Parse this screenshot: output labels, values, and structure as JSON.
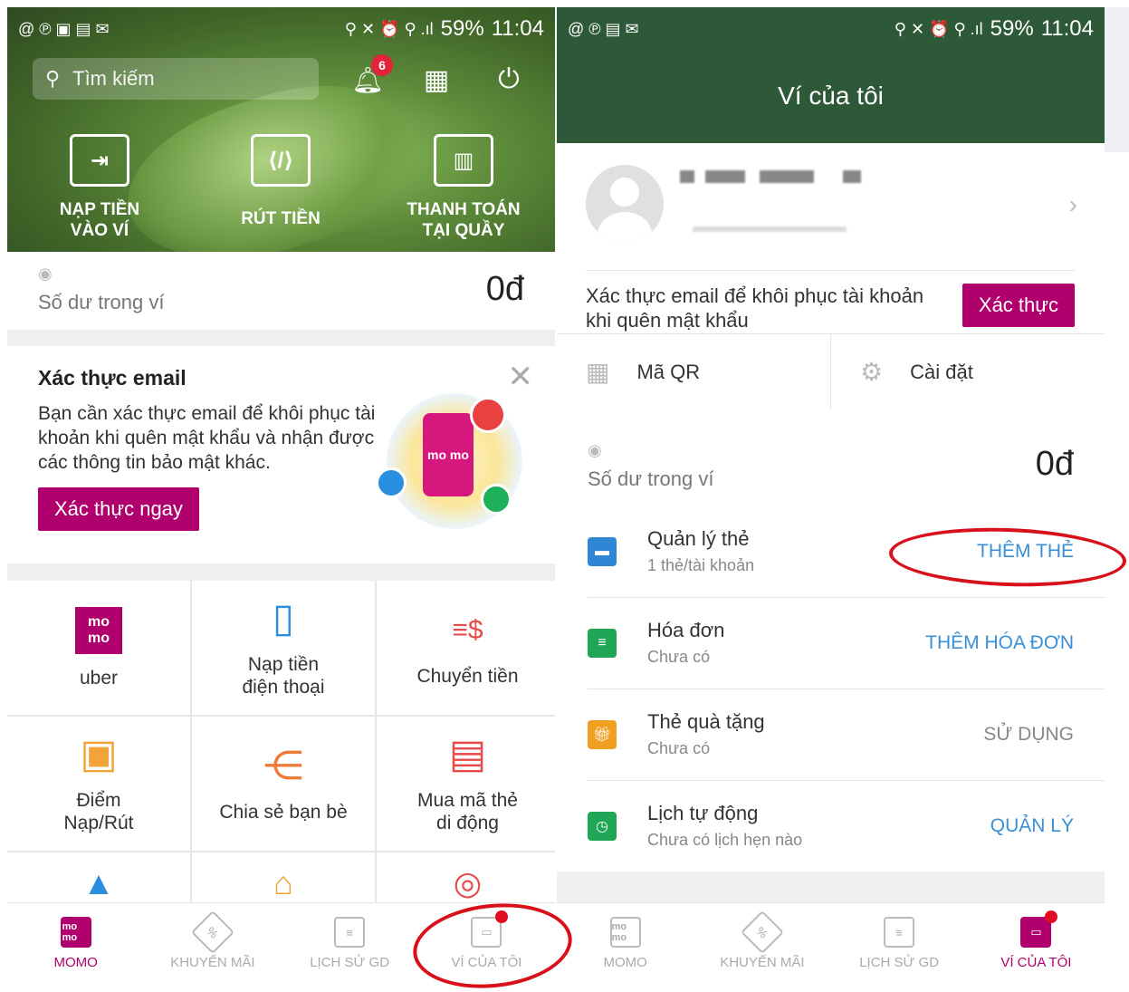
{
  "left": {
    "status": {
      "left_icons": "@ ℗ ▣ ▤ ✉",
      "right_icons": "⚲ ✕ ⏰ ⚲ .ıl",
      "battery": "59%",
      "time": "11:04"
    },
    "search_placeholder": "Tìm kiếm",
    "notif_count": "6",
    "actions": [
      {
        "label_line1": "NẠP TIỀN",
        "label_line2": "VÀO VÍ"
      },
      {
        "label_line1": "RÚT TIỀN",
        "label_line2": ""
      },
      {
        "label_line1": "THANH TOÁN",
        "label_line2": "TẠI QUẦY"
      }
    ],
    "balance": {
      "label": "Số dư trong ví",
      "value": "0đ"
    },
    "email_card": {
      "title": "Xác thực email",
      "body": "Bạn cần xác thực email để khôi phục tài khoản khi quên mật khẩu và nhận được các thông tin bảo mật khác.",
      "button": "Xác thực ngay",
      "close": "✕",
      "logo_text": "mo mo"
    },
    "services": [
      {
        "label1": "uber",
        "label2": "",
        "icon": "momo-icon"
      },
      {
        "label1": "Nạp tiền",
        "label2": "điện thoại",
        "icon": "phone-icon"
      },
      {
        "label1": "Chuyển tiền",
        "label2": "",
        "icon": "money-transfer-icon"
      },
      {
        "label1": "Điểm",
        "label2": "Nạp/Rút",
        "icon": "store-icon"
      },
      {
        "label1": "Chia sẻ bạn bè",
        "label2": "",
        "icon": "share-icon"
      },
      {
        "label1": "Mua mã thẻ",
        "label2": "di động",
        "icon": "card-code-icon"
      }
    ]
  },
  "right": {
    "status": {
      "left_icons": "@ ℗ ▤ ✉",
      "right_icons": "⚲ ✕ ⏰ ⚲ .ıl",
      "battery": "59%",
      "time": "11:04"
    },
    "title": "Ví của tôi",
    "verify": {
      "text": "Xác thực email để khôi phục tài khoản khi quên mật khẩu",
      "button": "Xác thực"
    },
    "qr_label": "Mã QR",
    "settings_label": "Cài đặt",
    "balance": {
      "label": "Số dư trong ví",
      "value": "0đ"
    },
    "rows": [
      {
        "title": "Quản lý thẻ",
        "sub": "1 thẻ/tài khoản",
        "action": "THÊM THẺ",
        "color": "#2f86d4"
      },
      {
        "title": "Hóa đơn",
        "sub": "Chưa có",
        "action": "THÊM HÓA ĐƠN",
        "color": "#1fa657"
      },
      {
        "title": "Thẻ quà tặng",
        "sub": "Chưa có",
        "action": "SỬ DỤNG",
        "color": "#f0a020"
      },
      {
        "title": "Lịch tự động",
        "sub": "Chưa có lịch hẹn nào",
        "action": "QUẢN LÝ",
        "color": "#1fa657"
      }
    ]
  },
  "tabs": [
    "MOMO",
    "KHUYẾN MÃI",
    "LỊCH SỬ GD",
    "VÍ CỦA TÔI"
  ],
  "tab_icons": {
    "momo": "mo mo"
  },
  "colors": {
    "brand": "#b0006d",
    "header_green": "#2e5939",
    "link_blue": "#3a8fd6",
    "annotation_red": "#d7101a"
  }
}
